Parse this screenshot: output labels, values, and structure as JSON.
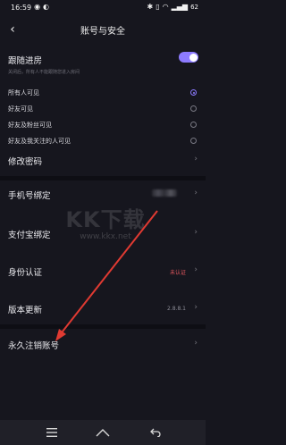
{
  "status_bar": {
    "time": "16:59",
    "battery": "62"
  },
  "header": {
    "title": "账号与安全"
  },
  "follow_room": {
    "label": "跟随进房",
    "description": "关闭后，所有人不能跟随您进入房间",
    "enabled": true,
    "options": [
      {
        "label": "所有人可见",
        "selected": true
      },
      {
        "label": "好友可见",
        "selected": false
      },
      {
        "label": "好友及粉丝可见",
        "selected": false
      },
      {
        "label": "好友及我关注的人可见",
        "selected": false
      }
    ]
  },
  "settings": {
    "change_password": "修改密码",
    "phone_binding": "手机号绑定",
    "alipay_binding": "支付宝绑定",
    "identity_auth": "身份认证",
    "identity_status": "未认证",
    "version_update": "版本更新",
    "version_number": "2.8.8.1",
    "delete_account": "永久注销账号"
  },
  "watermark": {
    "logo": "KK下载",
    "url": "www.kkx.net"
  },
  "colors": {
    "accent": "#8d7bff",
    "warning": "#e5585f",
    "annotation_arrow": "#e03a32"
  }
}
